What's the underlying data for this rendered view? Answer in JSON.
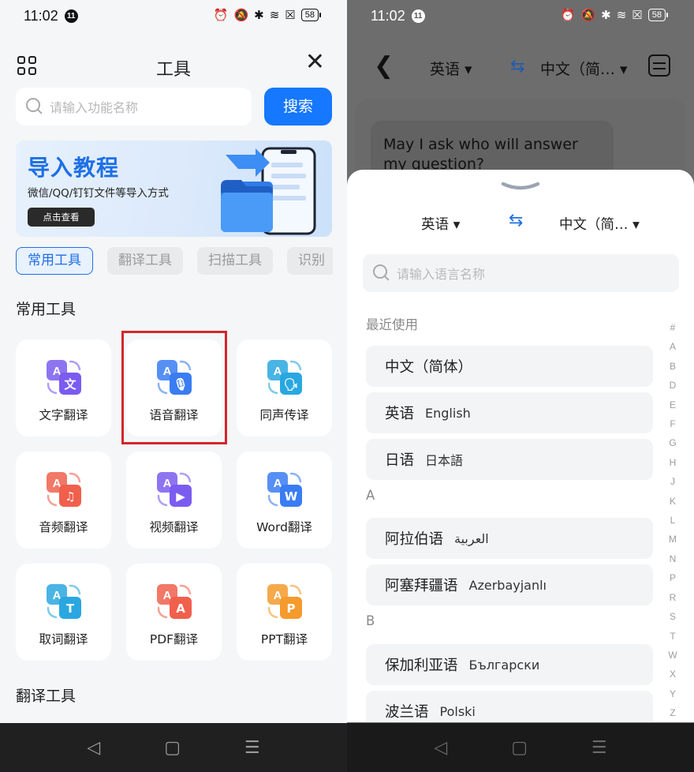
{
  "left": {
    "status": {
      "time": "11:02",
      "notification_count": "11",
      "battery": "58"
    },
    "header": {
      "title": "工具"
    },
    "search": {
      "placeholder": "请输入功能名称",
      "button": "搜索"
    },
    "banner": {
      "title": "导入教程",
      "subtitle": "微信/QQ/钉钉文件等导入方式",
      "button": "点击查看"
    },
    "category_tabs": [
      "常用工具",
      "翻译工具",
      "扫描工具",
      "识别"
    ],
    "section_common": "常用工具",
    "section_translate": "翻译工具",
    "tools": [
      {
        "label": "文字翻译",
        "icon": "text-translate-icon",
        "color": "#7b5cf0"
      },
      {
        "label": "语音翻译",
        "icon": "voice-translate-icon",
        "color": "#3a7df2"
      },
      {
        "label": "同声传译",
        "icon": "simultaneous-interpret-icon",
        "color": "#2aa7e0"
      },
      {
        "label": "音频翻译",
        "icon": "audio-translate-icon",
        "color": "#f0604c"
      },
      {
        "label": "视频翻译",
        "icon": "video-translate-icon",
        "color": "#7b5cf0"
      },
      {
        "label": "Word翻译",
        "icon": "word-translate-icon",
        "color": "#3a7df2"
      },
      {
        "label": "取词翻译",
        "icon": "word-pick-translate-icon",
        "color": "#2aa7e0"
      },
      {
        "label": "PDF翻译",
        "icon": "pdf-translate-icon",
        "color": "#f0604c"
      },
      {
        "label": "PPT翻译",
        "icon": "ppt-translate-icon",
        "color": "#f59a2c"
      }
    ],
    "highlighted_tool": "语音翻译"
  },
  "right": {
    "status": {
      "time": "11:02",
      "notification_count": "11",
      "battery": "58"
    },
    "header": {
      "source_lang": "英语",
      "target_lang": "中文（简…"
    },
    "background_text": "May I ask who will answer my question?",
    "sheet": {
      "source_lang": "英语",
      "target_lang": "中文（简…",
      "search_placeholder": "请输入语言名称",
      "recent_label": "最近使用",
      "recent": [
        {
          "zh": "中文（简体）",
          "native": ""
        },
        {
          "zh": "英语",
          "native": "English"
        },
        {
          "zh": "日语",
          "native": "日本語"
        }
      ],
      "group_a_label": "A",
      "group_a": [
        {
          "zh": "阿拉伯语",
          "native": "العربية"
        },
        {
          "zh": "阿塞拜疆语",
          "native": "Azerbayjanlı"
        }
      ],
      "group_b_label": "B",
      "group_b": [
        {
          "zh": "保加利亚语",
          "native": "Български"
        },
        {
          "zh": "波兰语",
          "native": "Polski"
        }
      ],
      "alphabet": [
        "#",
        "A",
        "B",
        "D",
        "E",
        "F",
        "G",
        "H",
        "J",
        "K",
        "L",
        "M",
        "N",
        "P",
        "R",
        "S",
        "T",
        "W",
        "X",
        "Y",
        "Z"
      ]
    }
  },
  "colors": {
    "accent": "#1677ff",
    "highlight": "#d2272c"
  }
}
